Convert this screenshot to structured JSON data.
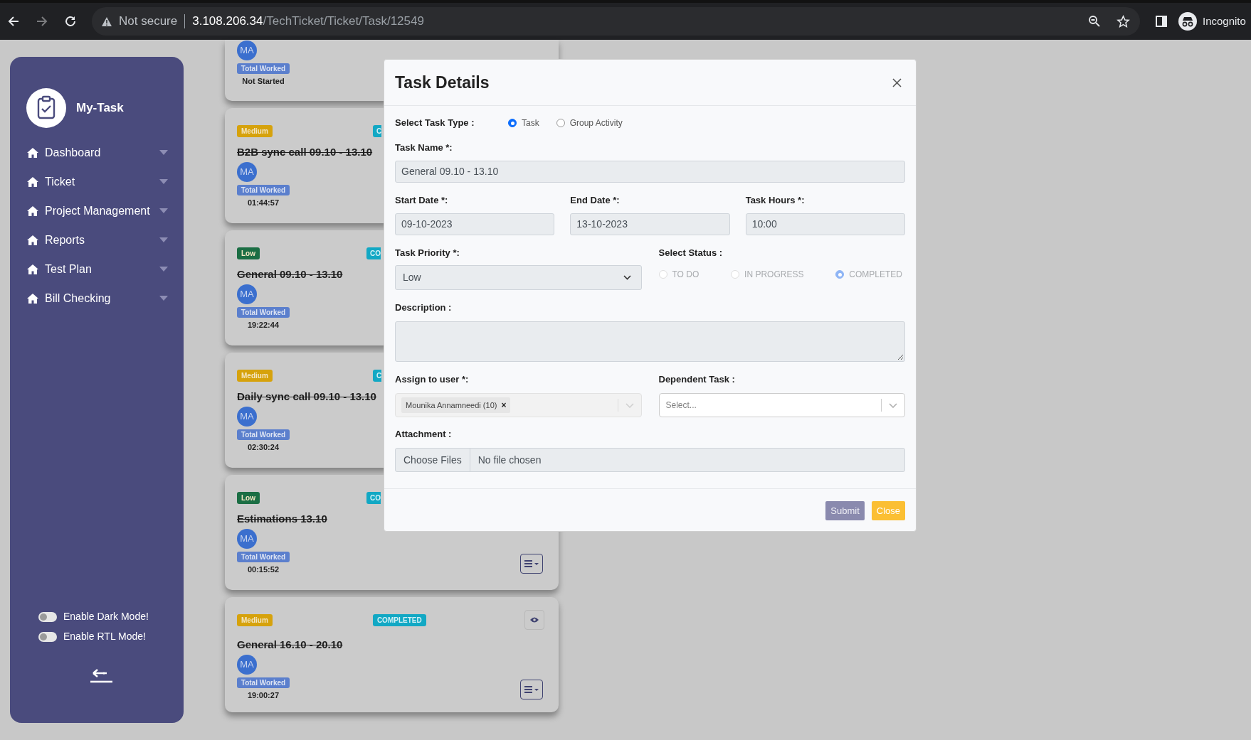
{
  "browser": {
    "security": "Not secure",
    "url_host": "3.108.206.34",
    "url_path": "/TechTicket/Ticket/Task/12549",
    "forward_disabled": true,
    "profile": "Incognito"
  },
  "sidebar": {
    "brand": "My-Task",
    "items": [
      {
        "label": "Dashboard"
      },
      {
        "label": "Ticket"
      },
      {
        "label": "Project Management"
      },
      {
        "label": "Reports"
      },
      {
        "label": "Test Plan"
      },
      {
        "label": "Bill Checking"
      }
    ],
    "toggles": [
      {
        "label": "Enable Dark Mode!",
        "on": false
      },
      {
        "label": "Enable RTL Mode!",
        "on": false
      }
    ]
  },
  "cards": [
    {
      "avatar": "MA",
      "worked_label": "Total Worked",
      "worked_time": "Not Started"
    },
    {
      "priority": {
        "label": "Medium",
        "color": "#d6a20c"
      },
      "status": {
        "label": "C",
        "cut": true
      },
      "title": "B2B sync call 09.10 - 13.10",
      "struck": true,
      "avatar": "MA",
      "worked_label": "Total Worked",
      "worked_time": "01:44:57"
    },
    {
      "priority": {
        "label": "Low",
        "color": "#1b6e44"
      },
      "status": {
        "label": "CO",
        "cut": true
      },
      "title": "General 09.10 - 13.10",
      "struck": true,
      "avatar": "MA",
      "worked_label": "Total Worked",
      "worked_time": "19:22:44"
    },
    {
      "priority": {
        "label": "Medium",
        "color": "#d6a20c"
      },
      "status": {
        "label": "C",
        "cut": true
      },
      "title": "Daily sync call 09.10 - 13.10",
      "struck": true,
      "avatar": "MA",
      "worked_label": "Total Worked",
      "worked_time": "02:30:24"
    },
    {
      "priority": {
        "label": "Low",
        "color": "#1b6e44"
      },
      "status": {
        "label": "CO",
        "cut": true
      },
      "title": "Estimations 13.10",
      "struck": true,
      "avatar": "MA",
      "worked_label": "Total Worked",
      "worked_time": "00:15:52",
      "actions": [
        {
          "kind": "menu"
        }
      ]
    },
    {
      "priority": {
        "label": "Medium",
        "color": "#d6a20c"
      },
      "status": {
        "label": "COMPLETED",
        "cut": false
      },
      "title": "General 16.10 - 20.10",
      "struck": true,
      "avatar": "MA",
      "worked_label": "Total Worked",
      "worked_time": "19:00:27",
      "actions": [
        {
          "kind": "view"
        },
        {
          "kind": "menu"
        }
      ]
    }
  ],
  "modal": {
    "title": "Task Details",
    "task_type": {
      "label": "Select Task Type :",
      "options": [
        {
          "label": "Task",
          "selected": true
        },
        {
          "label": "Group Activity",
          "selected": false
        }
      ]
    },
    "task_name": {
      "label": "Task Name *:",
      "value": "General 09.10 - 13.10"
    },
    "start_date": {
      "label": "Start Date *:",
      "value": "09-10-2023"
    },
    "end_date": {
      "label": "End Date *:",
      "value": "13-10-2023"
    },
    "task_hours": {
      "label": "Task Hours *:",
      "value": "10:00"
    },
    "priority": {
      "label": "Task Priority *:",
      "value": "Low"
    },
    "status": {
      "label": "Select Status :",
      "disabled": true,
      "options": [
        {
          "label": "TO DO",
          "selected": false
        },
        {
          "label": "IN PROGRESS",
          "selected": false
        },
        {
          "label": "COMPLETED",
          "selected": true
        }
      ]
    },
    "description": {
      "label": "Description :"
    },
    "assign": {
      "label": "Assign to user *:",
      "tags": [
        "Mounika Annamneedi (10)"
      ],
      "tag_remove": "×",
      "disabled": true
    },
    "dependent": {
      "label": "Dependent Task :",
      "placeholder": "Select..."
    },
    "attachment": {
      "label": "Attachment :",
      "button": "Choose Files",
      "status": "No file chosen"
    },
    "buttons": [
      {
        "label": "Submit",
        "kind": "primary"
      },
      {
        "label": "Close",
        "kind": "warning"
      }
    ]
  }
}
